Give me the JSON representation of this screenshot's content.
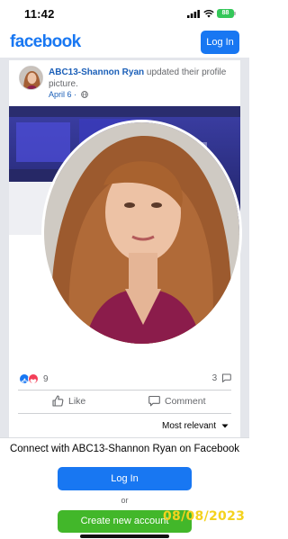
{
  "status_bar": {
    "time": "11:42",
    "battery": "88"
  },
  "header": {
    "logo": "facebook",
    "login_label": "Log In"
  },
  "post": {
    "author": "ABC13-Shannon Ryan",
    "action_text": "updated their profile picture.",
    "date": "April 6",
    "separator": "·",
    "visibility_icon": "globe-icon",
    "reaction_icons": [
      "like-reaction-icon",
      "love-reaction-icon"
    ],
    "reaction_count": "9",
    "comment_count": "3",
    "like_label": "Like",
    "comment_label": "Comment",
    "sort_label": "Most relevant"
  },
  "login_sheet": {
    "title": "Connect with ABC13-Shannon Ryan on Facebook",
    "login_label": "Log In",
    "or_label": "or",
    "create_label": "Create new account"
  },
  "overlay": {
    "date_stamp": "08/08/2023"
  },
  "colors": {
    "brand_blue": "#1877f2",
    "create_green": "#42b72a",
    "stamp_yellow": "#f4d21e",
    "love_red": "#f33e58"
  }
}
